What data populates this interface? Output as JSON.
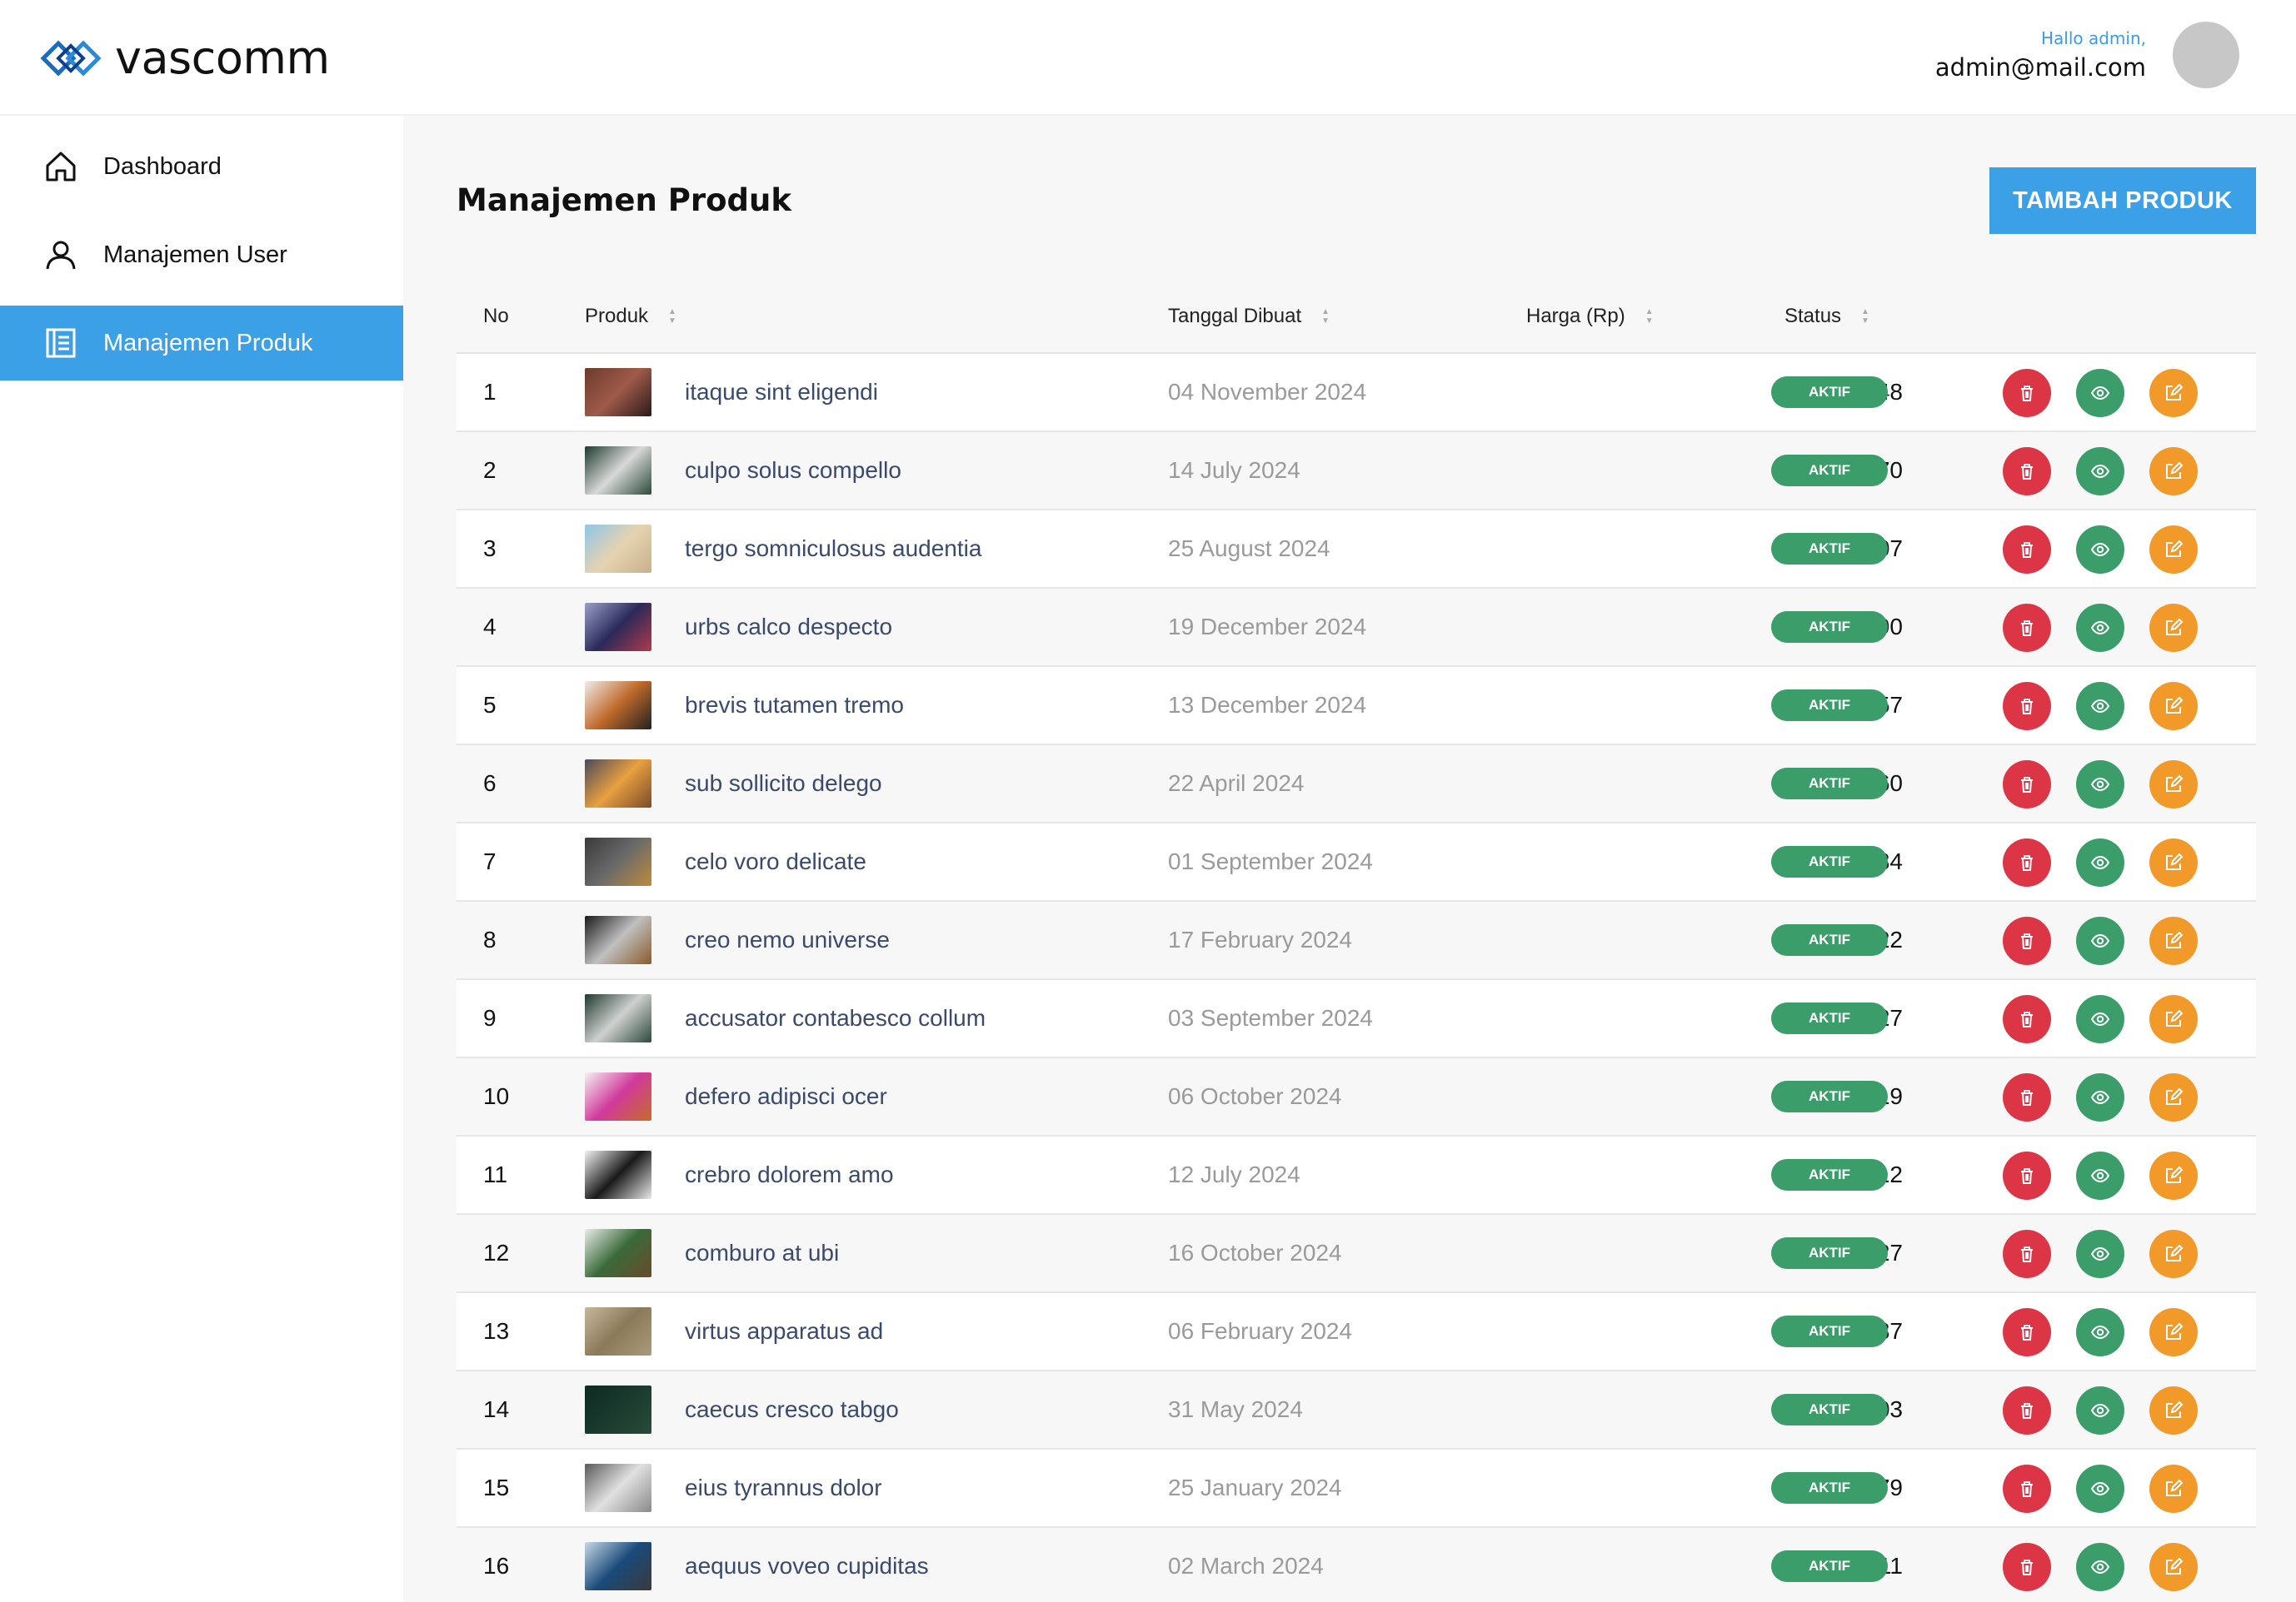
{
  "header": {
    "logo_text": "vascomm",
    "greeting": "Hallo admin,",
    "email": "admin@mail.com"
  },
  "sidebar": {
    "items": [
      {
        "label": "Dashboard",
        "icon": "home-icon",
        "active": false
      },
      {
        "label": "Manajemen User",
        "icon": "user-icon",
        "active": false
      },
      {
        "label": "Manajemen Produk",
        "icon": "document-icon",
        "active": true
      }
    ]
  },
  "main": {
    "title": "Manajemen Produk",
    "add_button": "TAMBAH PRODUK",
    "columns": [
      "No",
      "Produk",
      "Tanggal Dibuat",
      "Harga (Rp)",
      "Status"
    ],
    "rows": [
      {
        "no": "1",
        "name": "itaque sint eligendi",
        "date": "04 November 2024",
        "price": "Rp 770.148",
        "status": "AKTIF",
        "thumb": [
          "#6a3a2a",
          "#a05a4a",
          "#2a1a1a"
        ]
      },
      {
        "no": "2",
        "name": "culpo solus compello",
        "date": "14 July 2024",
        "price": "Rp 345.570",
        "status": "AKTIF",
        "thumb": [
          "#1e3a2e",
          "#d8d8d8",
          "#2c4a3a"
        ]
      },
      {
        "no": "3",
        "name": "tergo somniculosus audentia",
        "date": "25 August 2024",
        "price": "Rp 722.207",
        "status": "AKTIF",
        "thumb": [
          "#8ec6e8",
          "#e6d3b0",
          "#c8b08a"
        ]
      },
      {
        "no": "4",
        "name": "urbs calco despecto",
        "date": "19 December 2024",
        "price": "Rp 45.390",
        "status": "AKTIF",
        "thumb": [
          "#9aa0c8",
          "#2a2a5a",
          "#b03a4a"
        ]
      },
      {
        "no": "5",
        "name": "brevis tutamen tremo",
        "date": "13 December 2024",
        "price": "Rp 310.657",
        "status": "AKTIF",
        "thumb": [
          "#f0ece8",
          "#c06a2a",
          "#222222"
        ]
      },
      {
        "no": "6",
        "name": "sub sollicito delego",
        "date": "22 April 2024",
        "price": "Rp 18.760",
        "status": "AKTIF",
        "thumb": [
          "#4a4a5a",
          "#e8a040",
          "#7a4a2a"
        ]
      },
      {
        "no": "7",
        "name": "celo voro delicate",
        "date": "01 September 2024",
        "price": "Rp 21.134",
        "status": "AKTIF",
        "thumb": [
          "#3a3a3a",
          "#6a6a6a",
          "#c08a3a"
        ]
      },
      {
        "no": "8",
        "name": "creo nemo universe",
        "date": "17 February 2024",
        "price": "Rp 148.422",
        "status": "AKTIF",
        "thumb": [
          "#1a1a1a",
          "#c0c0c0",
          "#8a5a2a"
        ]
      },
      {
        "no": "9",
        "name": "accusator contabesco collum",
        "date": "03 September 2024",
        "price": "Rp 192.127",
        "status": "AKTIF",
        "thumb": [
          "#1e3a2e",
          "#d0d0d0",
          "#2c4a3a"
        ]
      },
      {
        "no": "10",
        "name": "defero adipisci ocer",
        "date": "06 October 2024",
        "price": "Rp 370.119",
        "status": "AKTIF",
        "thumb": [
          "#f4f0f4",
          "#d03a9a",
          "#c86a2a"
        ]
      },
      {
        "no": "11",
        "name": "crebro dolorem amo",
        "date": "12 July 2024",
        "price": "Rp 482.912",
        "status": "AKTIF",
        "thumb": [
          "#f2f2f2",
          "#1a1a1a",
          "#e8e8e8"
        ]
      },
      {
        "no": "12",
        "name": "comburo at ubi",
        "date": "16 October 2024",
        "price": "Rp 150.227",
        "status": "AKTIF",
        "thumb": [
          "#e8ece8",
          "#3a6a3a",
          "#6a4a2a"
        ]
      },
      {
        "no": "13",
        "name": "virtus apparatus ad",
        "date": "06 February 2024",
        "price": "Rp 564.037",
        "status": "AKTIF",
        "thumb": [
          "#c8b89a",
          "#8a7a5a",
          "#a89a7a"
        ]
      },
      {
        "no": "14",
        "name": "caecus cresco tabgo",
        "date": "31 May 2024",
        "price": "Rp 523.403",
        "status": "AKTIF",
        "thumb": [
          "#0e2a22",
          "#1a3a2e",
          "#2a4a3a"
        ]
      },
      {
        "no": "15",
        "name": "eius tyrannus dolor",
        "date": "25 January 2024",
        "price": "Rp 883.179",
        "status": "AKTIF",
        "thumb": [
          "#5a5a5a",
          "#e0e0e0",
          "#8a8a8a"
        ]
      },
      {
        "no": "16",
        "name": "aequus voveo cupiditas",
        "date": "02 March 2024",
        "price": "Rp 616.511",
        "status": "AKTIF",
        "thumb": [
          "#c8d8e8",
          "#1a4a7a",
          "#3a3a3a"
        ]
      }
    ]
  },
  "colors": {
    "accent": "#3ba0e6",
    "status_active": "#3a9d6a",
    "delete": "#dc3545",
    "view": "#3a9d6a",
    "edit": "#f19a2a"
  }
}
